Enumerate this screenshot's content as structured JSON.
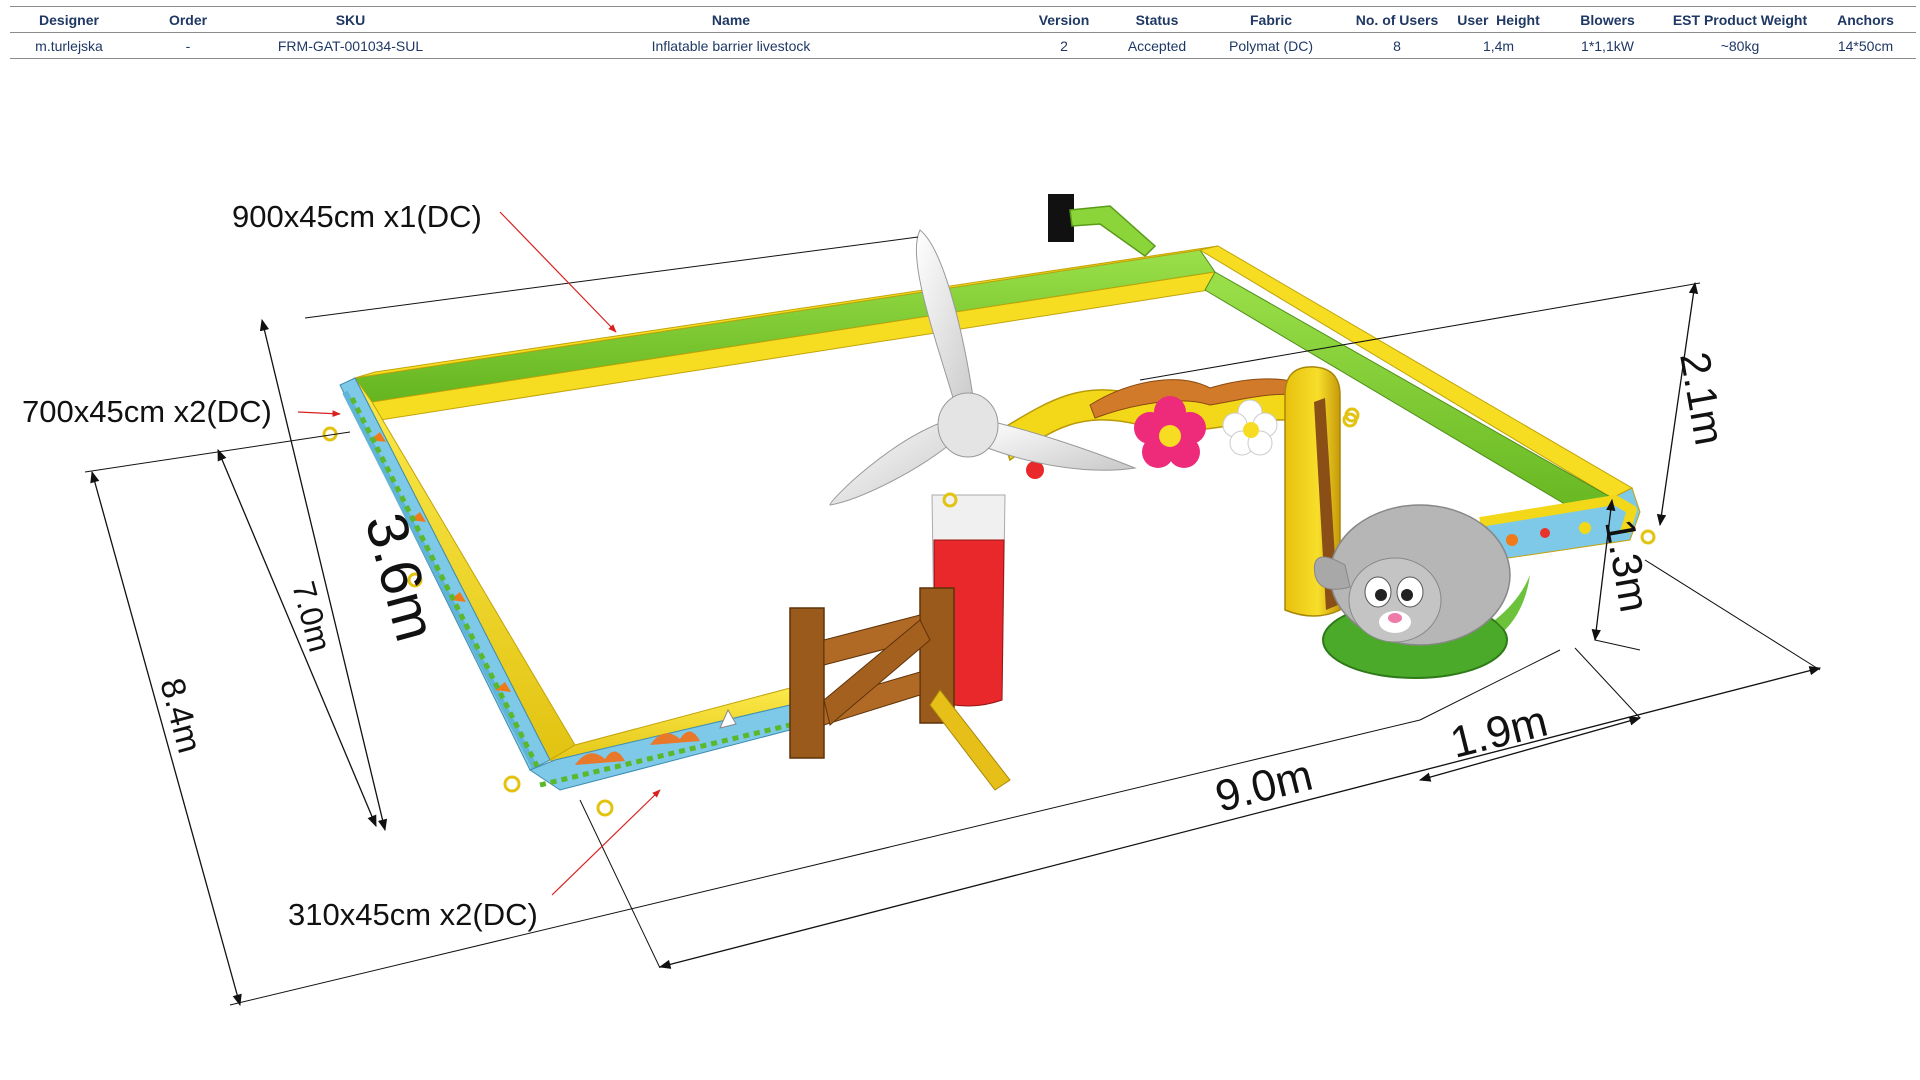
{
  "table": {
    "headers": [
      "Designer",
      "Order",
      "SKU",
      "Name",
      "Version",
      "Status",
      "Fabric",
      "No. of Users",
      "User  Height",
      "Blowers",
      "EST Product Weight",
      "Anchors"
    ],
    "row": [
      "m.turlejska",
      "-",
      "FRM-GAT-001034-SUL",
      "Inflatable barrier livestock",
      "2",
      "Accepted",
      "Polymat (DC)",
      "8",
      "1,4m",
      "1*1,1kW",
      "~80kg",
      "14*50cm"
    ]
  },
  "callouts": {
    "top_tube": "900x45cm x1(DC)",
    "side_tube": "700x45cm x2(DC)",
    "front_tube": "310x45cm x2(DC)"
  },
  "dimensions": {
    "depth_outer": "8.4m",
    "depth_inner": "7.0m",
    "depth_wall": "3.6m",
    "length_front": "9.0m",
    "length_right": "1.9m",
    "height_total": "2.1m",
    "height_arch": "1.3m"
  },
  "colors": {
    "tube_green": "#7ccc2c",
    "tube_yellow": "#f2d818",
    "fence_brown": "#9a5a1c",
    "windmill_red": "#e8282a",
    "arrow_red": "#d9201e"
  }
}
